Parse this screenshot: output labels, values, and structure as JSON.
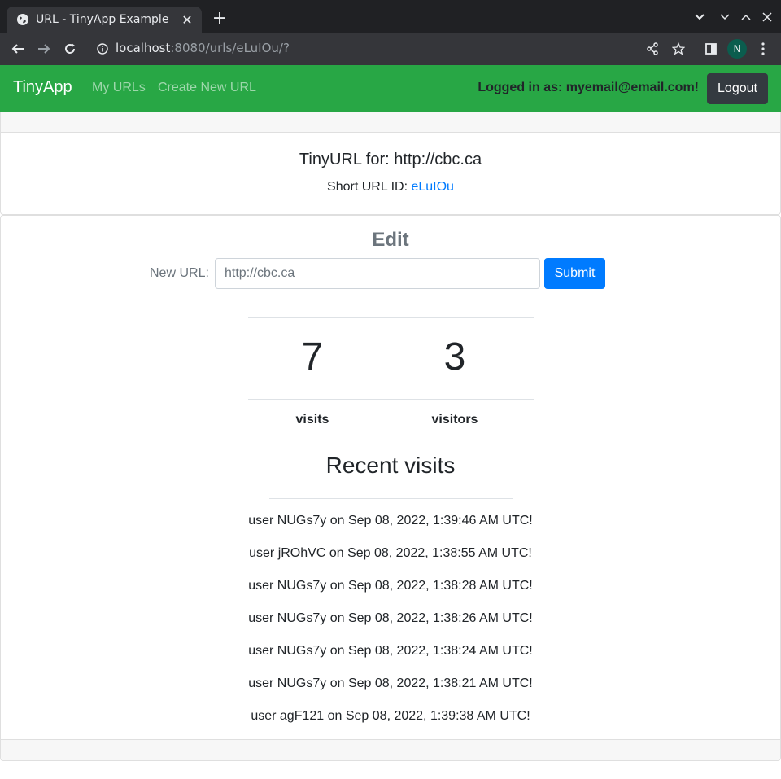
{
  "browser": {
    "tab_title": "URL - TinyApp Example",
    "url_host": "localhost",
    "url_rest": ":8080/urls/eLuIOu/?",
    "profile_initial": "N"
  },
  "navbar": {
    "brand": "TinyApp",
    "links": [
      "My URLs",
      "Create New URL"
    ],
    "logged_in": "Logged in as: myemail@email.com!",
    "logout_label": "Logout"
  },
  "summary": {
    "heading": "TinyURL for: http://cbc.ca",
    "short_label": "Short URL ID: ",
    "short_id": "eLuIOu"
  },
  "edit": {
    "title": "Edit",
    "label": "New URL:",
    "placeholder": "http://cbc.ca",
    "submit_label": "Submit"
  },
  "stats": {
    "visits": "7",
    "visits_label": "visits",
    "visitors": "3",
    "visitors_label": "visitors"
  },
  "recent": {
    "title": "Recent visits",
    "items": [
      "user NUGs7y on Sep 08, 2022, 1:39:46 AM UTC!",
      "user jROhVC on Sep 08, 2022, 1:38:55 AM UTC!",
      "user NUGs7y on Sep 08, 2022, 1:38:28 AM UTC!",
      "user NUGs7y on Sep 08, 2022, 1:38:26 AM UTC!",
      "user NUGs7y on Sep 08, 2022, 1:38:24 AM UTC!",
      "user NUGs7y on Sep 08, 2022, 1:38:21 AM UTC!",
      "user agF121 on Sep 08, 2022, 1:39:38 AM UTC!"
    ]
  },
  "colors": {
    "navbar_green": "#28a745",
    "link_blue": "#007bff",
    "logout_dark": "#343a40"
  }
}
